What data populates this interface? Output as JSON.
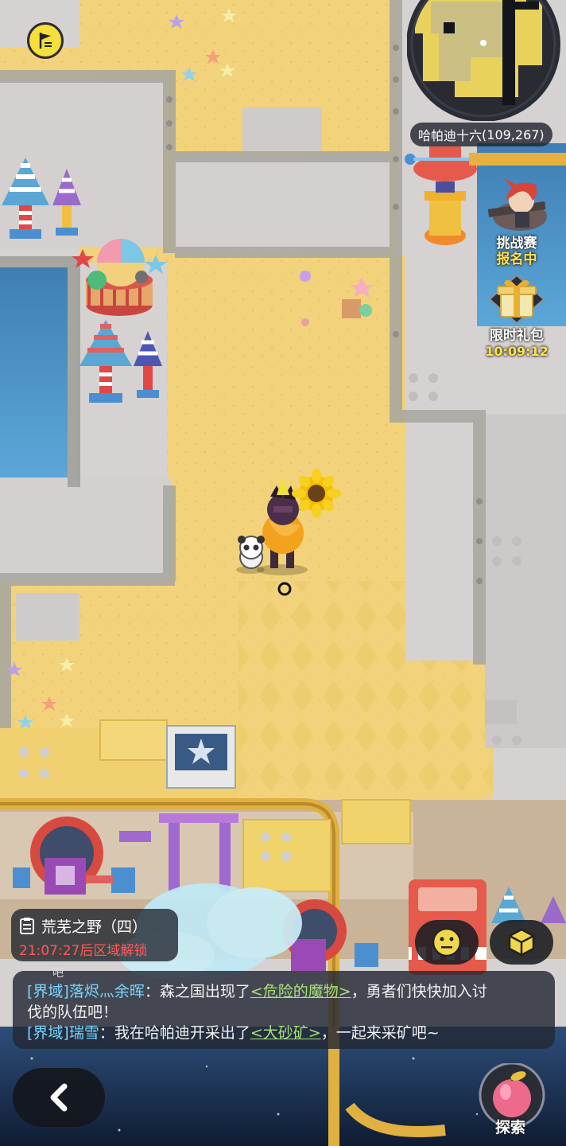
{
  "minimap": {
    "location_name": "哈帕迪十六",
    "coordinates": "(109,267)"
  },
  "events": [
    {
      "title": "挑战赛",
      "status": "报名中",
      "icon": "challenge-character-icon"
    },
    {
      "title": "限时礼包",
      "status": "10:09:12",
      "icon": "gift-box-icon"
    }
  ],
  "zone": {
    "name": "荒芜之野（四）",
    "unlock_text": "21:07:27后区域解锁"
  },
  "chat": {
    "partial_label": "吧",
    "messages": [
      {
        "channel": "[界域]",
        "name": "落烬灬余晖",
        "pre": "：森之国出现了",
        "link": "<危险的魔物>",
        "post": "，勇者们快快加入讨",
        "cont": "伐的队伍吧！"
      },
      {
        "channel": "[界域]",
        "name": "瑞雪",
        "pre": "：我在哈帕迪开采出了",
        "link": "<大砂矿>",
        "post": "，一起来采矿吧~"
      }
    ]
  },
  "buttons": {
    "explore_label": "探索",
    "back_icon": "back-arrow-icon",
    "emote_icon": "smiley-icon",
    "inventory_icon": "cube-icon",
    "flag_icon": "flag-icon"
  },
  "colors": {
    "sand": "#f0d27a",
    "stone": "#d9d6d5",
    "water": "#4a90c4",
    "link": "#a7e27a",
    "channel": "#79d6ff",
    "unlock": "#ff5a5a",
    "event_status": "#ffe14a"
  }
}
